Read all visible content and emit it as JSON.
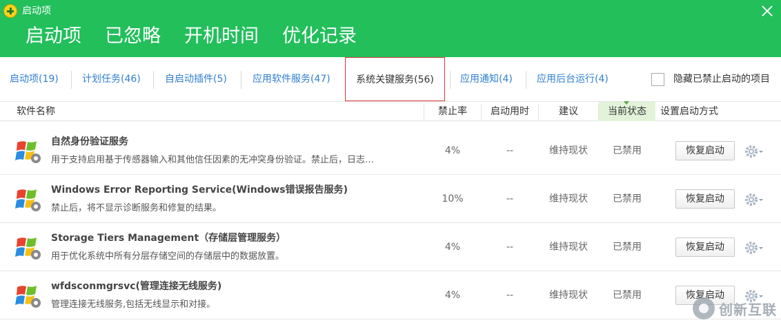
{
  "window": {
    "title": "启动项",
    "close_label": "✕"
  },
  "main_tabs": [
    {
      "label": "启动项"
    },
    {
      "label": "已忽略"
    },
    {
      "label": "开机时间"
    },
    {
      "label": "优化记录"
    }
  ],
  "sub_tabs": [
    {
      "label": "启动项(19)"
    },
    {
      "label": "计划任务(46)"
    },
    {
      "label": "自启动插件(5)"
    },
    {
      "label": "应用软件服务(47)"
    },
    {
      "label": "系统关键服务(56)"
    },
    {
      "label": "应用通知(4)"
    },
    {
      "label": "应用后台运行(4)"
    }
  ],
  "hide_disabled": {
    "label": "隐藏已禁止启动的项目",
    "checked": false
  },
  "columns": {
    "name": "软件名称",
    "block_rate": "禁止率",
    "boot_time": "启动用时",
    "advice": "建议",
    "status": "当前状态",
    "set_mode": "设置启动方式"
  },
  "rows": [
    {
      "title": "自然身份验证服务",
      "desc": "用于支持启用基于传感器输入和其他信任因素的无冲突身份验证。禁止后，日志…",
      "rate": "4%",
      "time": "--",
      "advice": "维持现状",
      "status": "已禁用",
      "action": "恢复启动"
    },
    {
      "title": "Windows Error Reporting Service(Windows错误报告服务)",
      "desc": "禁止后，将不显示诊断服务和修复的结果。",
      "rate": "10%",
      "time": "--",
      "advice": "维持现状",
      "status": "已禁用",
      "action": "恢复启动"
    },
    {
      "title": "Storage Tiers Management（存储层管理服务）",
      "desc": "用于优化系统中所有分层存储空间的存储层中的数据放置。",
      "rate": "4%",
      "time": "--",
      "advice": "维持现状",
      "status": "已禁用",
      "action": "恢复启动"
    },
    {
      "title": "wfdsconmgrsvc(管理连接无线服务)",
      "desc": "管理连接无线服务,包括无线显示和对接。",
      "rate": "4%",
      "time": "--",
      "advice": "维持现状",
      "status": "已禁用",
      "action": "恢复启动"
    }
  ],
  "watermark": {
    "text": "创新互联"
  },
  "colors": {
    "header_green": "#22bf5b",
    "link_blue": "#2f7fd0",
    "active_tab_border": "#d63838",
    "status_column_bg": "#e2f3da"
  }
}
